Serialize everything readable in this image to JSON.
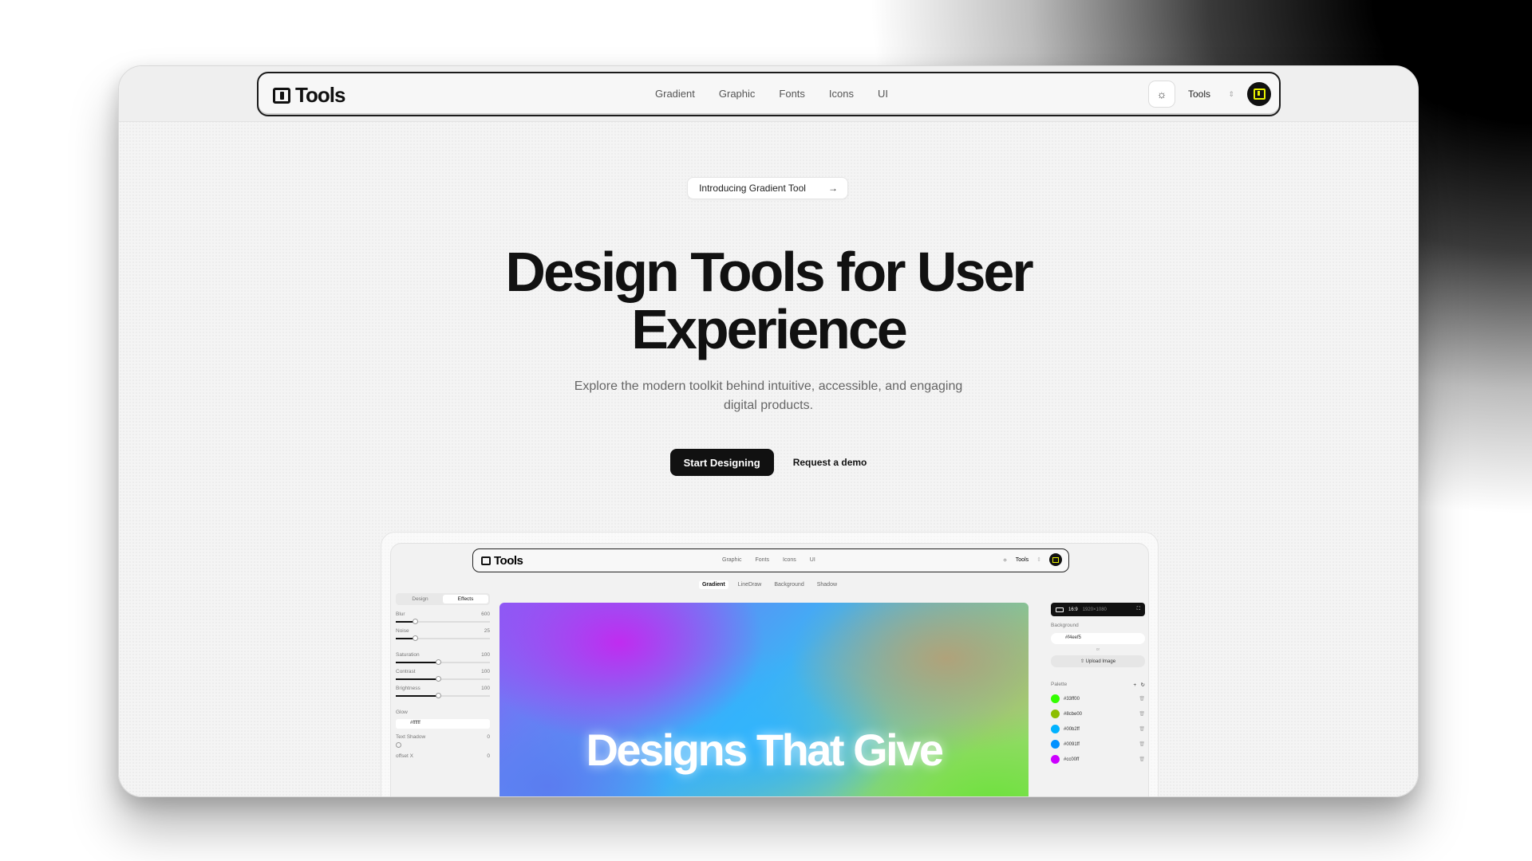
{
  "brand": {
    "name": "Tools"
  },
  "nav": {
    "links": [
      "Gradient",
      "Graphic",
      "Fonts",
      "Icons",
      "UI"
    ],
    "tools_select": "Tools",
    "theme_icon": "sun-icon"
  },
  "hero": {
    "pill_text": "Introducing Gradient Tool",
    "title": "Design Tools for User Experience",
    "subtitle": "Explore the modern toolkit behind intuitive, accessible, and engaging digital products.",
    "cta_primary": "Start Designing",
    "cta_secondary": "Request a demo"
  },
  "preview": {
    "brand": "Tools",
    "links": [
      "Graphic",
      "Fonts",
      "Icons",
      "UI"
    ],
    "tools_select": "Tools",
    "tabs": [
      "Gradient",
      "LineDraw",
      "Background",
      "Shadow"
    ],
    "left_segments": [
      "Design",
      "Effects"
    ],
    "controls": [
      {
        "label": "Blur",
        "value": "600",
        "level": 0.2
      },
      {
        "label": "Noise",
        "value": "25",
        "level": 0.2
      },
      {
        "label": "Saturation",
        "value": "100",
        "level": 0.45
      },
      {
        "label": "Contrast",
        "value": "100",
        "level": 0.45
      },
      {
        "label": "Brightness",
        "value": "100",
        "level": 0.45
      }
    ],
    "glow_label": "Glow",
    "glow_value": "#ffffff",
    "text_shadow_label": "Text Shadow",
    "text_shadow_value": "0",
    "offset_label": "offset X",
    "offset_value": "0",
    "canvas_text": "Designs That Give",
    "ratio": "16:9",
    "ratio_dims": "1920×1080",
    "background_label": "Background",
    "background_value": "#f4eef5",
    "or_text": "or",
    "upload_label": "Upload Image",
    "palette_label": "Palette",
    "palette": [
      {
        "hex": "#33ff00",
        "color": "#33ff00"
      },
      {
        "hex": "#8cbe00",
        "color": "#8cbe00"
      },
      {
        "hex": "#00b2ff",
        "color": "#00b2ff"
      },
      {
        "hex": "#0091ff",
        "color": "#0091ff"
      },
      {
        "hex": "#cc00ff",
        "color": "#cc00ff"
      }
    ]
  }
}
